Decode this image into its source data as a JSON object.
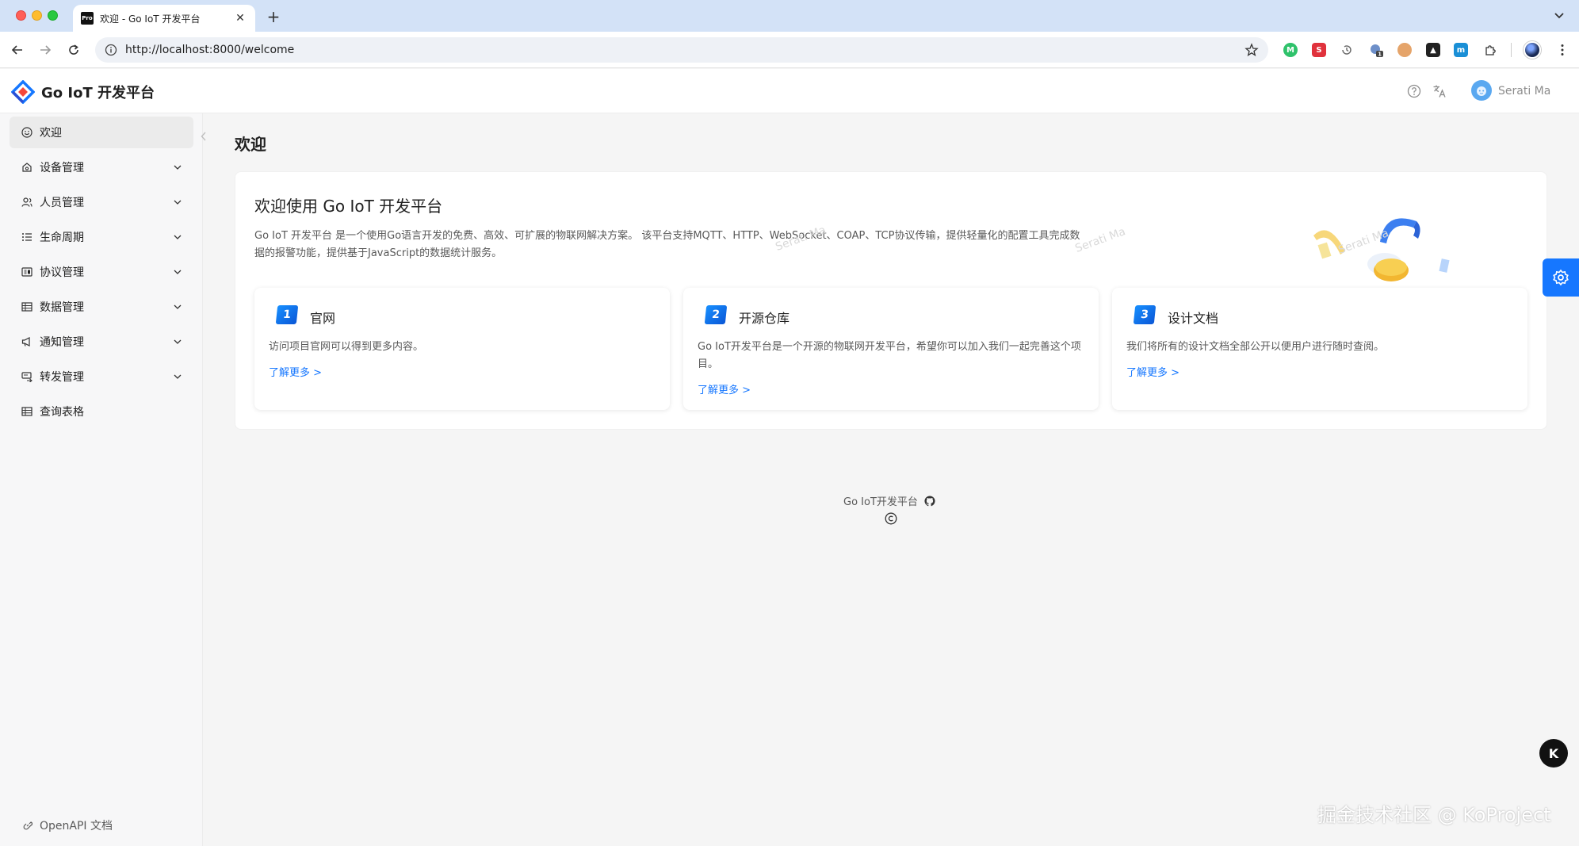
{
  "browser": {
    "tab_title": "欢迎 - Go IoT 开发平台",
    "tab_favicon_text": "Pro",
    "url": "http://localhost:8000/welcome",
    "extension_badge": "1"
  },
  "header": {
    "app_title": "Go IoT 开发平台",
    "user_name": "Serati Ma"
  },
  "sidebar": {
    "items": [
      {
        "label": "欢迎",
        "icon": "smile-icon"
      },
      {
        "label": "设备管理",
        "icon": "device-icon"
      },
      {
        "label": "人员管理",
        "icon": "user-icon"
      },
      {
        "label": "生命周期",
        "icon": "list-icon"
      },
      {
        "label": "协议管理",
        "icon": "protocol-icon"
      },
      {
        "label": "数据管理",
        "icon": "table-icon"
      },
      {
        "label": "通知管理",
        "icon": "notification-icon"
      },
      {
        "label": "转发管理",
        "icon": "forward-icon"
      },
      {
        "label": "查询表格",
        "icon": "table-icon"
      }
    ],
    "openapi_label": "OpenAPI 文档"
  },
  "main": {
    "page_title": "欢迎",
    "welcome": {
      "title": "欢迎使用 Go IoT 开发平台",
      "description": "Go IoT 开发平台 是一个使用Go语言开发的免费、高效、可扩展的物联网解决方案。 该平台支持MQTT、HTTP、WebSocket、COAP、TCP协议传输，提供轻量化的配置工具完成数据的报警功能，提供基于JavaScript的数据统计服务。",
      "watermark": "Serati Ma"
    },
    "features": [
      {
        "index": "1",
        "title": "官网",
        "desc": "访问项目官网可以得到更多内容。",
        "link": "了解更多 >"
      },
      {
        "index": "2",
        "title": "开源仓库",
        "desc": "Go IoT开发平台是一个开源的物联网开发平台，希望你可以加入我们一起完善这个项目。",
        "link": "了解更多 >"
      },
      {
        "index": "3",
        "title": "设计文档",
        "desc": "我们将所有的设计文档全部公开以便用户进行随时查阅。",
        "link": "了解更多 >"
      }
    ]
  },
  "footer": {
    "text": "Go IoT开发平台"
  },
  "overlay": {
    "fab_letter": "K",
    "corner_watermark": "掘金技术社区 @ KoProject"
  },
  "colors": {
    "primary": "#1677ff",
    "text": "#1f1f1f",
    "muted": "#595959"
  }
}
